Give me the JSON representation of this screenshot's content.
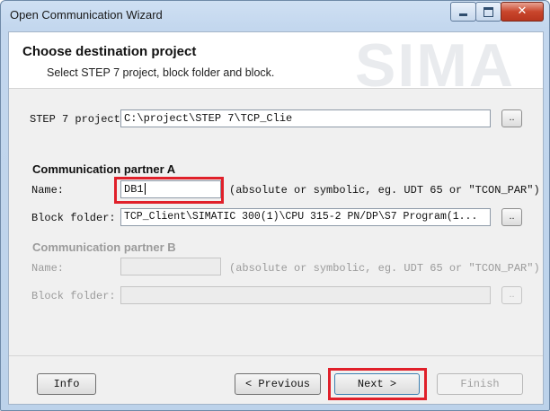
{
  "window": {
    "title": "Open Communication Wizard",
    "close_glyph": "✕"
  },
  "header": {
    "title": "Choose destination project",
    "subtitle": "Select STEP 7 project, block folder and block.",
    "background_text": "SIMA"
  },
  "project": {
    "label": "STEP 7 project",
    "value": "C:\\project\\STEP 7\\TCP_Clie",
    "browse_label": ".."
  },
  "partner_a": {
    "title": "Communication partner A",
    "name_label": "Name:",
    "name_value": "DB1",
    "hint": "(absolute or symbolic, eg. UDT 65 or \"TCON_PAR\")",
    "block_folder_label": "Block folder:",
    "block_folder_value": "TCP_Client\\SIMATIC 300(1)\\CPU 315-2 PN/DP\\S7 Program(1...",
    "browse_label": ".."
  },
  "partner_b": {
    "title": "Communication partner B",
    "name_label": "Name:",
    "name_value": "",
    "hint": "(absolute or symbolic, eg. UDT 65 or \"TCON_PAR\")",
    "block_folder_label": "Block folder:",
    "block_folder_value": "",
    "browse_label": ".."
  },
  "footer": {
    "info_label": "Info",
    "previous_label": "< Previous",
    "next_label": "Next >",
    "finish_label": "Finish"
  },
  "colors": {
    "highlight": "#e0202a",
    "disabled_text": "#9b9b9b"
  }
}
